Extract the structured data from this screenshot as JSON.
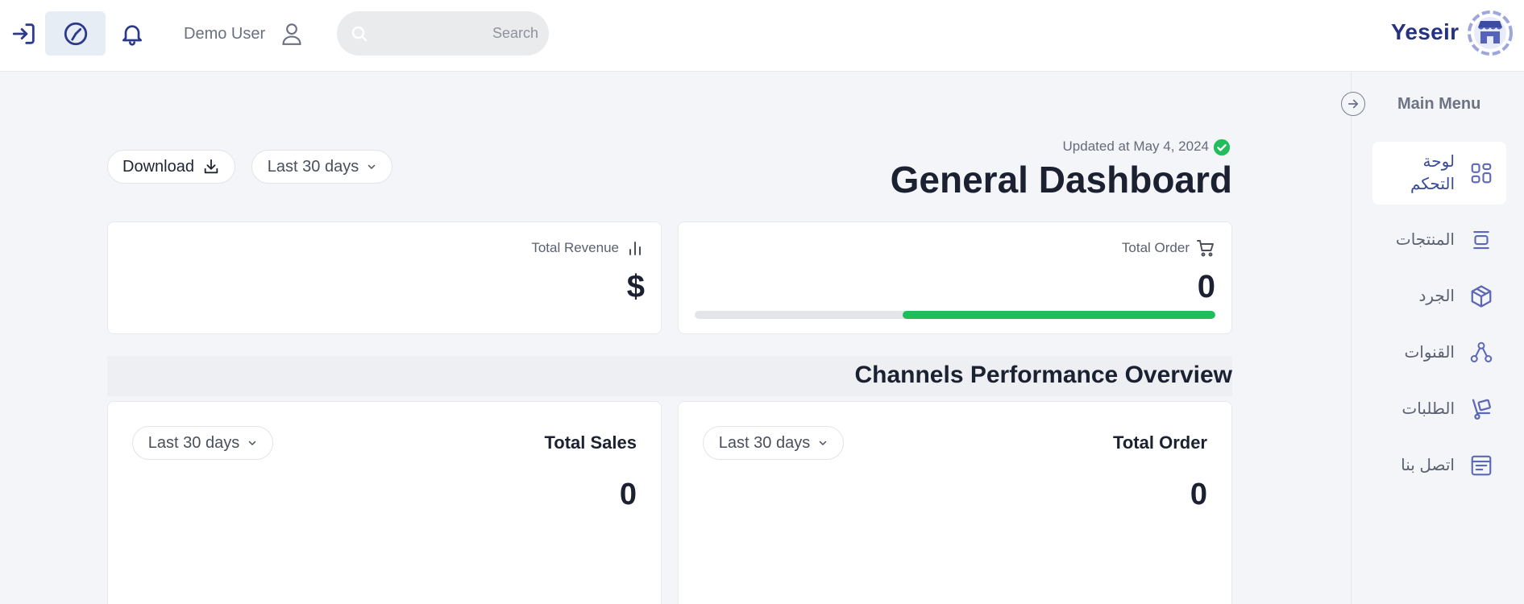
{
  "colors": {
    "brand": "#253283",
    "accent": "#5c67b6",
    "success": "#21bd5b",
    "background": "#f3f5f9",
    "card": "#ffffff"
  },
  "topbar": {
    "icons": [
      "login-icon",
      "history-icon",
      "bell-icon",
      "user-icon",
      "search-icon"
    ],
    "user_name": "Demo User",
    "search_placeholder": "Search",
    "brand_name": "Yeseir"
  },
  "sidebar": {
    "title": "Main Menu",
    "items": [
      {
        "label": "لوحة التحكم",
        "icon": "dashboard-icon",
        "active": true
      },
      {
        "label": "المنتجات",
        "icon": "products-icon",
        "active": false
      },
      {
        "label": "الجرد",
        "icon": "box-icon",
        "active": false
      },
      {
        "label": "القنوات",
        "icon": "channels-icon",
        "active": false
      },
      {
        "label": "الطلبات",
        "icon": "cart-dolly-icon",
        "active": false
      },
      {
        "label": "اتصل بنا",
        "icon": "contact-icon",
        "active": false
      }
    ]
  },
  "header": {
    "download_label": "Download",
    "range_label": "Last 30 days",
    "updated_text": "Updated at May 4, 2024",
    "title": "General Dashboard"
  },
  "kpis": {
    "revenue": {
      "label": "Total Revenue",
      "value": "$",
      "icon": "bar-chart-icon"
    },
    "order": {
      "label": "Total Order",
      "value": "0",
      "icon": "cart-icon",
      "progress_percent": 60
    }
  },
  "channels": {
    "title": "Channels Performance Overview",
    "sales": {
      "title": "Total Sales",
      "value": "0",
      "range_label": "Last 30 days"
    },
    "order": {
      "title": "Total Order",
      "value": "0",
      "range_label": "Last 30 days"
    }
  }
}
